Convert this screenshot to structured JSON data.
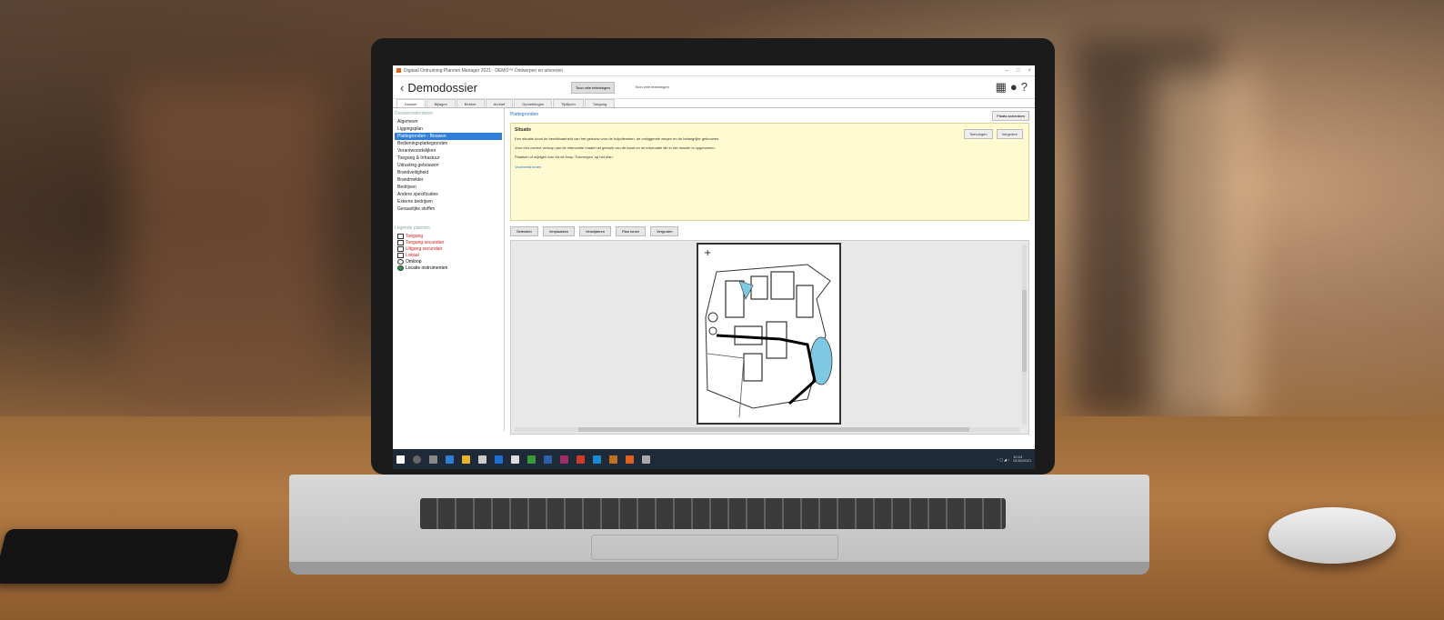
{
  "window": {
    "title": "Digitaal Ontruiming Plannen Manager 2021 - DEMO™ Ontwerpen en uitvoeren",
    "controls": [
      "–",
      "□",
      "×"
    ]
  },
  "header": {
    "back_icon": "chevron-left-icon",
    "title": "Demodossier",
    "action_button": "Toon vele tekeningen",
    "select_value": "Toon vele tekeningen",
    "icons": [
      "grid-icon",
      "user-icon",
      "help-icon"
    ]
  },
  "tabs": [
    "Dossier",
    "Bijlagen",
    "Beheer",
    "Archief",
    "Opmerkingen",
    "Tijdlijnen",
    "Toegang"
  ],
  "sidebar": {
    "heading": "Dossieronderdelen",
    "items": [
      "Algemeen",
      "Liggingsplan",
      "Plattegronden - Bouwen",
      "Bedieningsplattegronden",
      "Verantwoordelijken",
      "Toegang & Infrastuur",
      "Uitrusting gebouwen",
      "Brandveiligheid",
      "Brandmelder",
      "Bedrijven",
      "Andere specificaties",
      "Externe bedrijven",
      "Gevaarlijke stoffen"
    ],
    "active_index": 2,
    "legend_heading": "Legende plannen",
    "legend": [
      {
        "label": "Toegang",
        "color": "#d02020"
      },
      {
        "label": "Toegang secundair",
        "color": "#d02020"
      },
      {
        "label": "Uitgang secundair",
        "color": "#d02020"
      },
      {
        "label": "Lokaal",
        "color": "#d02020"
      },
      {
        "label": "Omloop",
        "color": "#222222"
      },
      {
        "label": "Locatie instrumenten",
        "color": "#222222"
      }
    ]
  },
  "main": {
    "breadcrumb": "Plattegronden",
    "top_button": "Plaats aanmaken",
    "info": {
      "title": "Situatie",
      "buttons": [
        "Toevoegen",
        "Vergroten"
      ],
      "paragraphs": [
        "Een situatie toont de bereikbaarheid van het gebouw voor de hulpdiensten, de omliggende wegen en de belangrijke gebouwen.",
        "Voor een correct verloop van de interventie maakt het gebruik van de kaart en de informatie die in het dossier is opgenomen.",
        "Plaatsen of wijzigen kan via de knop 'Toevoegen' op het plan."
      ],
      "link": "Voorbeeld tonen"
    },
    "toolbar": [
      "Selecteer",
      "Verplaatsen",
      "Verwijderen",
      "Plan tonen",
      "Vergroten"
    ]
  },
  "taskbar": {
    "time": "10:24",
    "date": "01/02/2021"
  },
  "colors": {
    "accent": "#2f7fd6",
    "info_bg": "#fffad0",
    "taskbar": "#1f2a38"
  }
}
